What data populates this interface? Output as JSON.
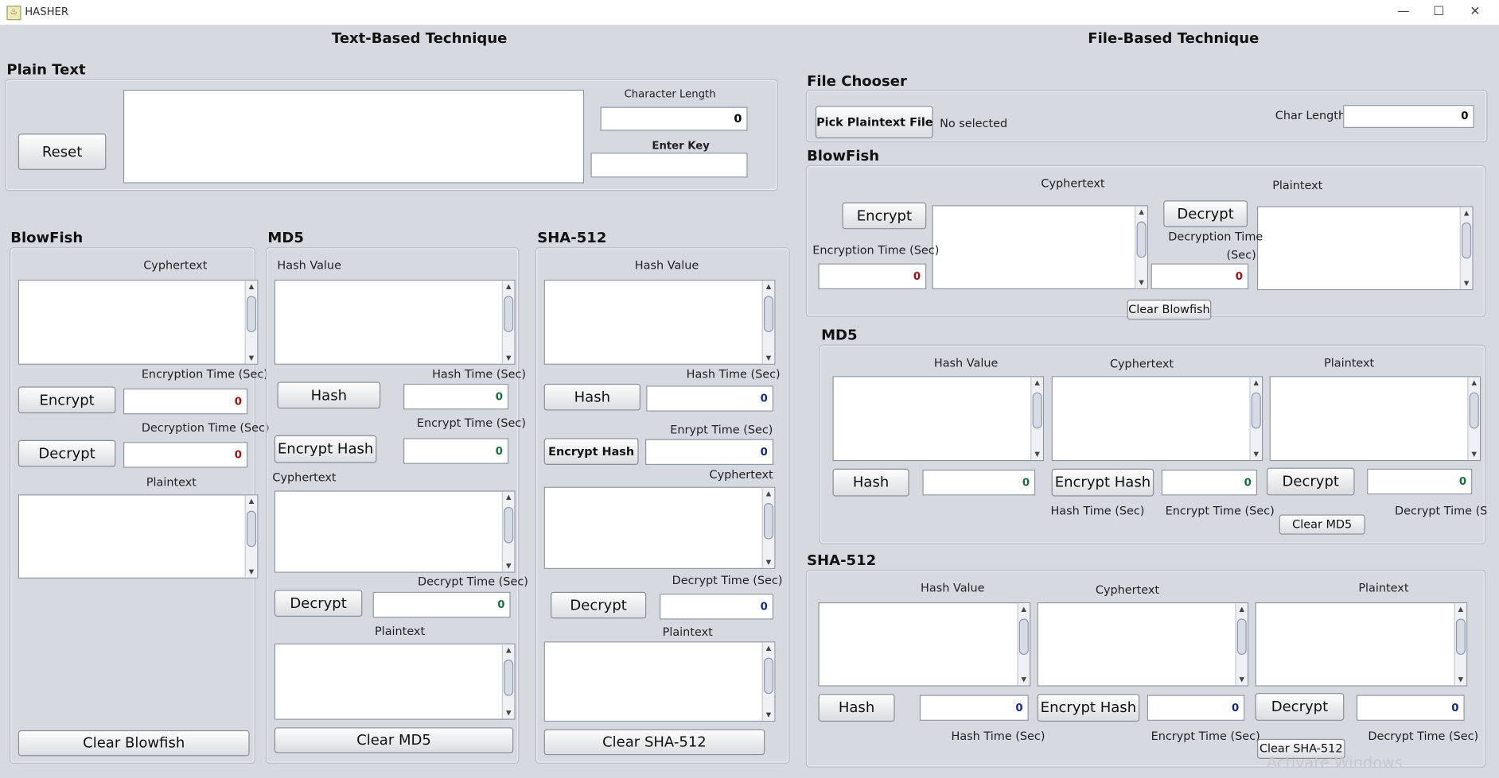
{
  "window": {
    "title": "HASHER",
    "minimize": "—",
    "maximize": "☐",
    "close": "✕"
  },
  "text": {
    "title": "Text-Based Technique",
    "plain_text_heading": "Plain Text",
    "reset": "Reset",
    "char_length_label": "Character Length",
    "char_length_value": "0",
    "enter_key_label": "Enter Key",
    "enter_key_value": "",
    "blowfish": {
      "heading": "BlowFish",
      "cyphertext": "Cyphertext",
      "enc_time_label": "Encryption Time (Sec)",
      "encrypt": "Encrypt",
      "enc_time": "0",
      "dec_time_label": "Decryption Time (Sec)",
      "decrypt": "Decrypt",
      "dec_time": "0",
      "plaintext": "Plaintext",
      "clear": "Clear Blowfish"
    },
    "md5": {
      "heading": "MD5",
      "hash_value": "Hash Value",
      "hash_time_label": "Hash Time (Sec)",
      "hash": "Hash",
      "hash_time": "0",
      "encrypt_time_label": "Encrypt Time (Sec)",
      "encrypt_hash": "Encrypt Hash",
      "encrypt_time": "0",
      "cyphertext": "Cyphertext",
      "decrypt_time_label": "Decrypt Time (Sec)",
      "decrypt": "Decrypt",
      "decrypt_time": "0",
      "plaintext": "Plaintext",
      "clear": "Clear MD5"
    },
    "sha": {
      "heading": "SHA-512",
      "hash_value": "Hash Value",
      "hash_time_label": "Hash Time (Sec)",
      "hash": "Hash",
      "hash_time": "0",
      "encrypt_time_label": "Enrypt Time (Sec)",
      "encrypt_hash": "Encrypt Hash",
      "encrypt_time": "0",
      "cyphertext": "Cyphertext",
      "decrypt_time_label": "Decrypt Time (Sec)",
      "decrypt": "Decrypt",
      "decrypt_time": "0",
      "plaintext": "Plaintext",
      "clear": "Clear SHA-512"
    }
  },
  "file": {
    "title": "File-Based Technique",
    "chooser_heading": "File Chooser",
    "pick": "Pick Plaintext File",
    "selected": "No selected",
    "char_length_label": "Char Length",
    "char_length_value": "0",
    "blowfish": {
      "heading": "BlowFish",
      "cyphertext": "Cyphertext",
      "plaintext": "Plaintext",
      "encrypt": "Encrypt",
      "decrypt": "Decrypt",
      "enc_time_label": "Encryption Time (Sec)",
      "enc_time": "0",
      "dec_time_label_1": "Decryption Time",
      "dec_time_label_2": "(Sec)",
      "dec_time": "0",
      "clear": "Clear Blowfish"
    },
    "md5": {
      "heading": "MD5",
      "hash_value": "Hash Value",
      "cyphertext": "Cyphertext",
      "plaintext": "Plaintext",
      "hash": "Hash",
      "hash_time": "0",
      "encrypt_hash": "Encrypt Hash",
      "encrypt_time": "0",
      "decrypt": "Decrypt",
      "decrypt_time": "0",
      "hash_time_label": "Hash Time (Sec)",
      "encrypt_time_label": "Encrypt Time (Sec)",
      "decrypt_time_label": "Decrypt Time (Sec)",
      "clear": "Clear MD5"
    },
    "sha": {
      "heading": "SHA-512",
      "hash_value": "Hash Value",
      "cyphertext": "Cyphertext",
      "plaintext": "Plaintext",
      "hash": "Hash",
      "hash_time": "0",
      "encrypt_hash": "Encrypt Hash",
      "encrypt_time": "0",
      "decrypt": "Decrypt",
      "decrypt_time": "0",
      "hash_time_label": "Hash Time (Sec)",
      "encrypt_time_label": "Encrypt Time (Sec)",
      "decrypt_time_label": "Decrypt Time (Sec)",
      "clear": "Clear SHA-512"
    }
  },
  "watermark": "Activate Windows"
}
